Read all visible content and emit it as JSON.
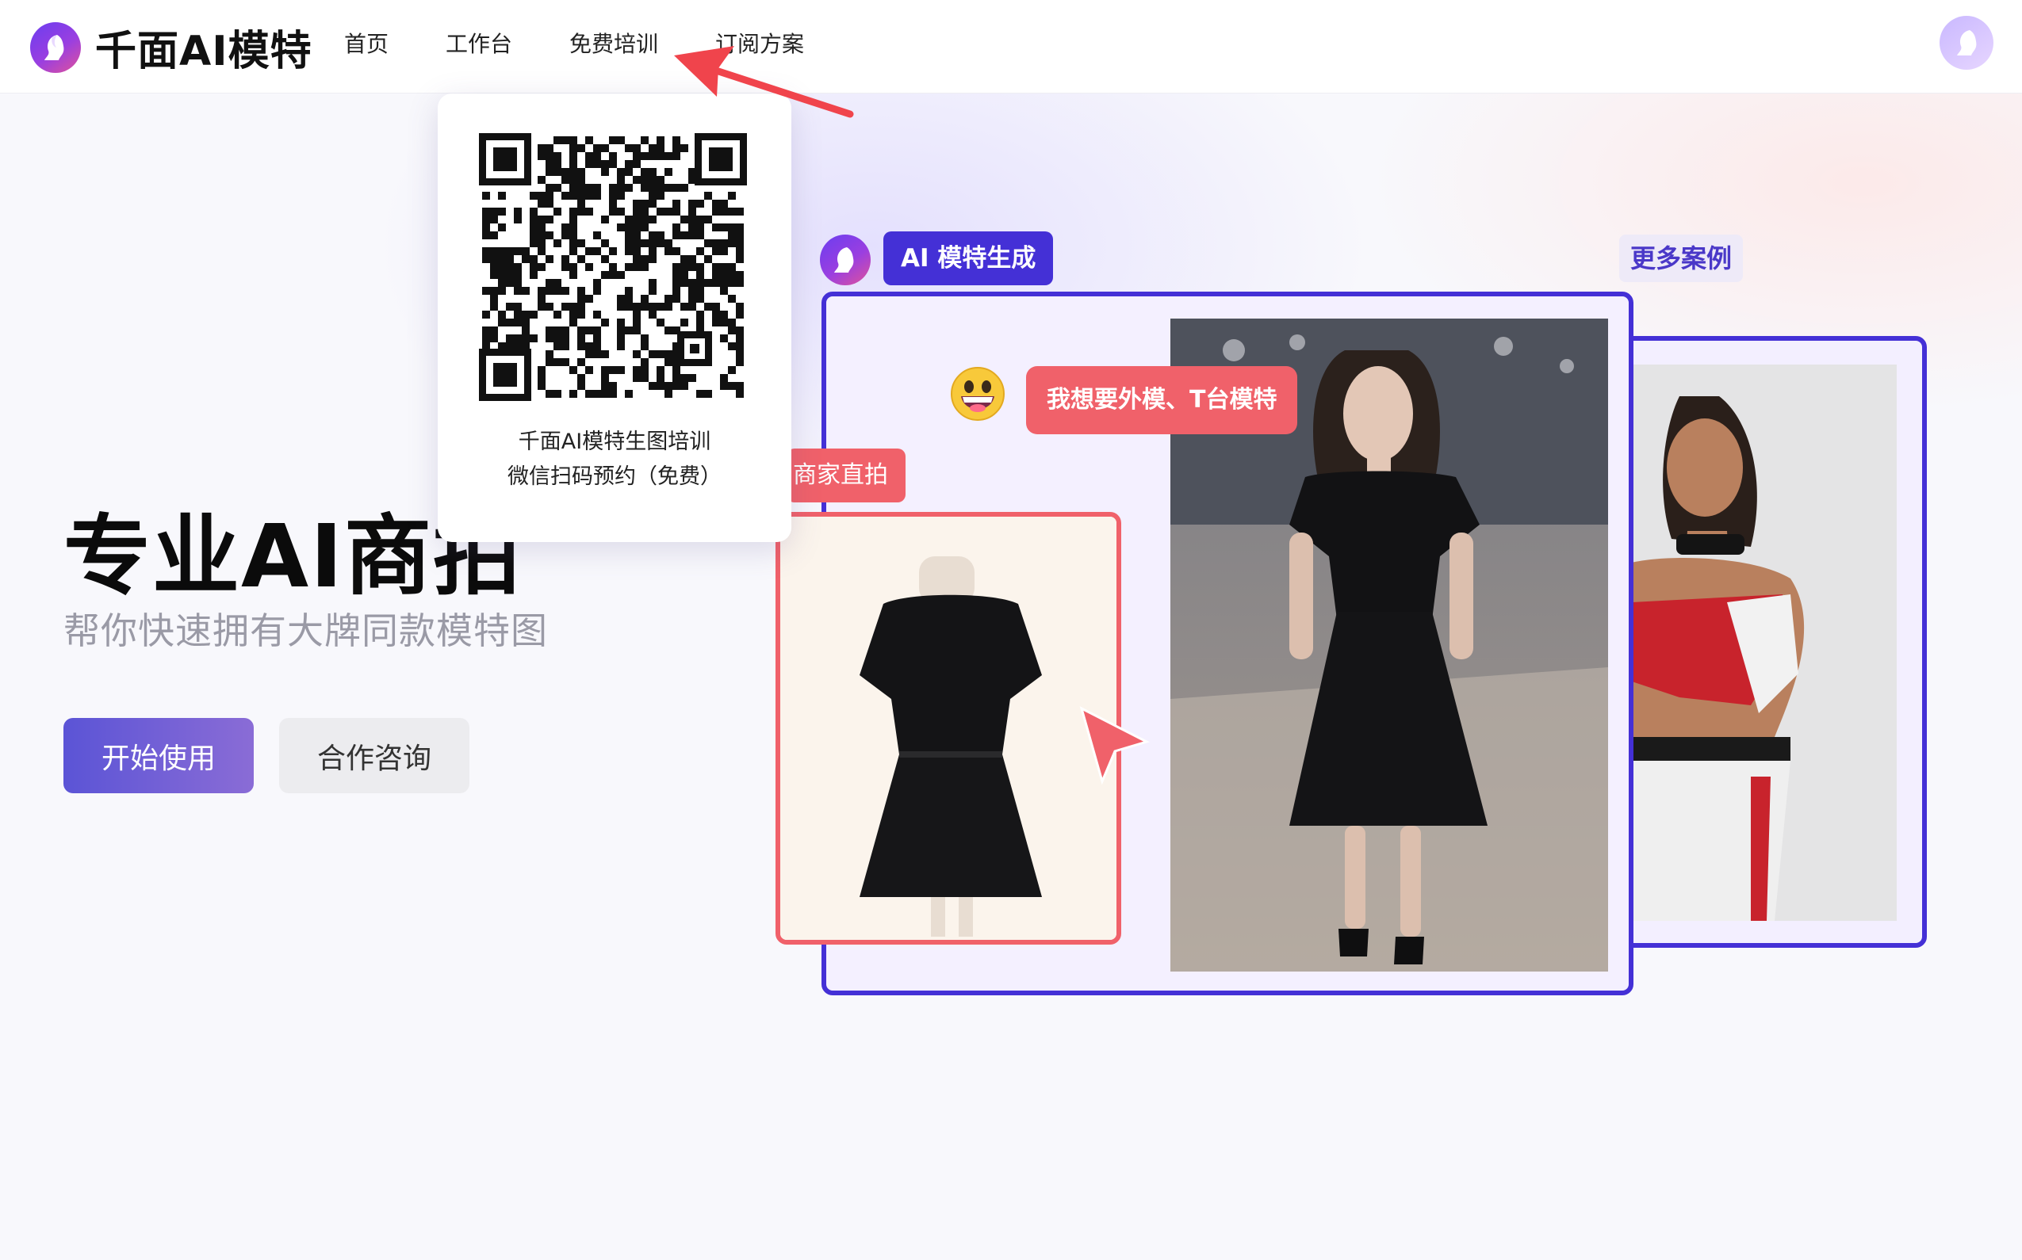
{
  "app": {
    "logo_text": "千面AI模特",
    "logo_icon": "brand-face-logo-icon",
    "avatar_icon": "user-avatar-icon"
  },
  "nav": {
    "items": [
      {
        "label": "首页"
      },
      {
        "label": "工作台"
      },
      {
        "label": "免费培训"
      },
      {
        "label": "订阅方案"
      }
    ]
  },
  "qr_popup": {
    "caption_line1": "千面AI模特生图培训",
    "caption_line2": "微信扫码预约（免费）",
    "icon": "qr-code-icon"
  },
  "hero": {
    "title": "专业AI商拍",
    "subtitle": "帮你快速拥有大牌同款模特图",
    "primary_button": "开始使用",
    "secondary_button": "合作咨询"
  },
  "showcase": {
    "ai_tag": "AI 模特生成",
    "more_cases": "更多案例",
    "speech_bubble": "我想要外模、T台模特",
    "merchant_tag": "商家直拍",
    "emoji_icon": "grinning-emoji-icon",
    "cursor_icon": "pointer-cursor-icon"
  },
  "colors": {
    "brand_purple": "#4430d6",
    "accent_red": "#f0616a",
    "annotation_arrow": "#f0444c"
  }
}
